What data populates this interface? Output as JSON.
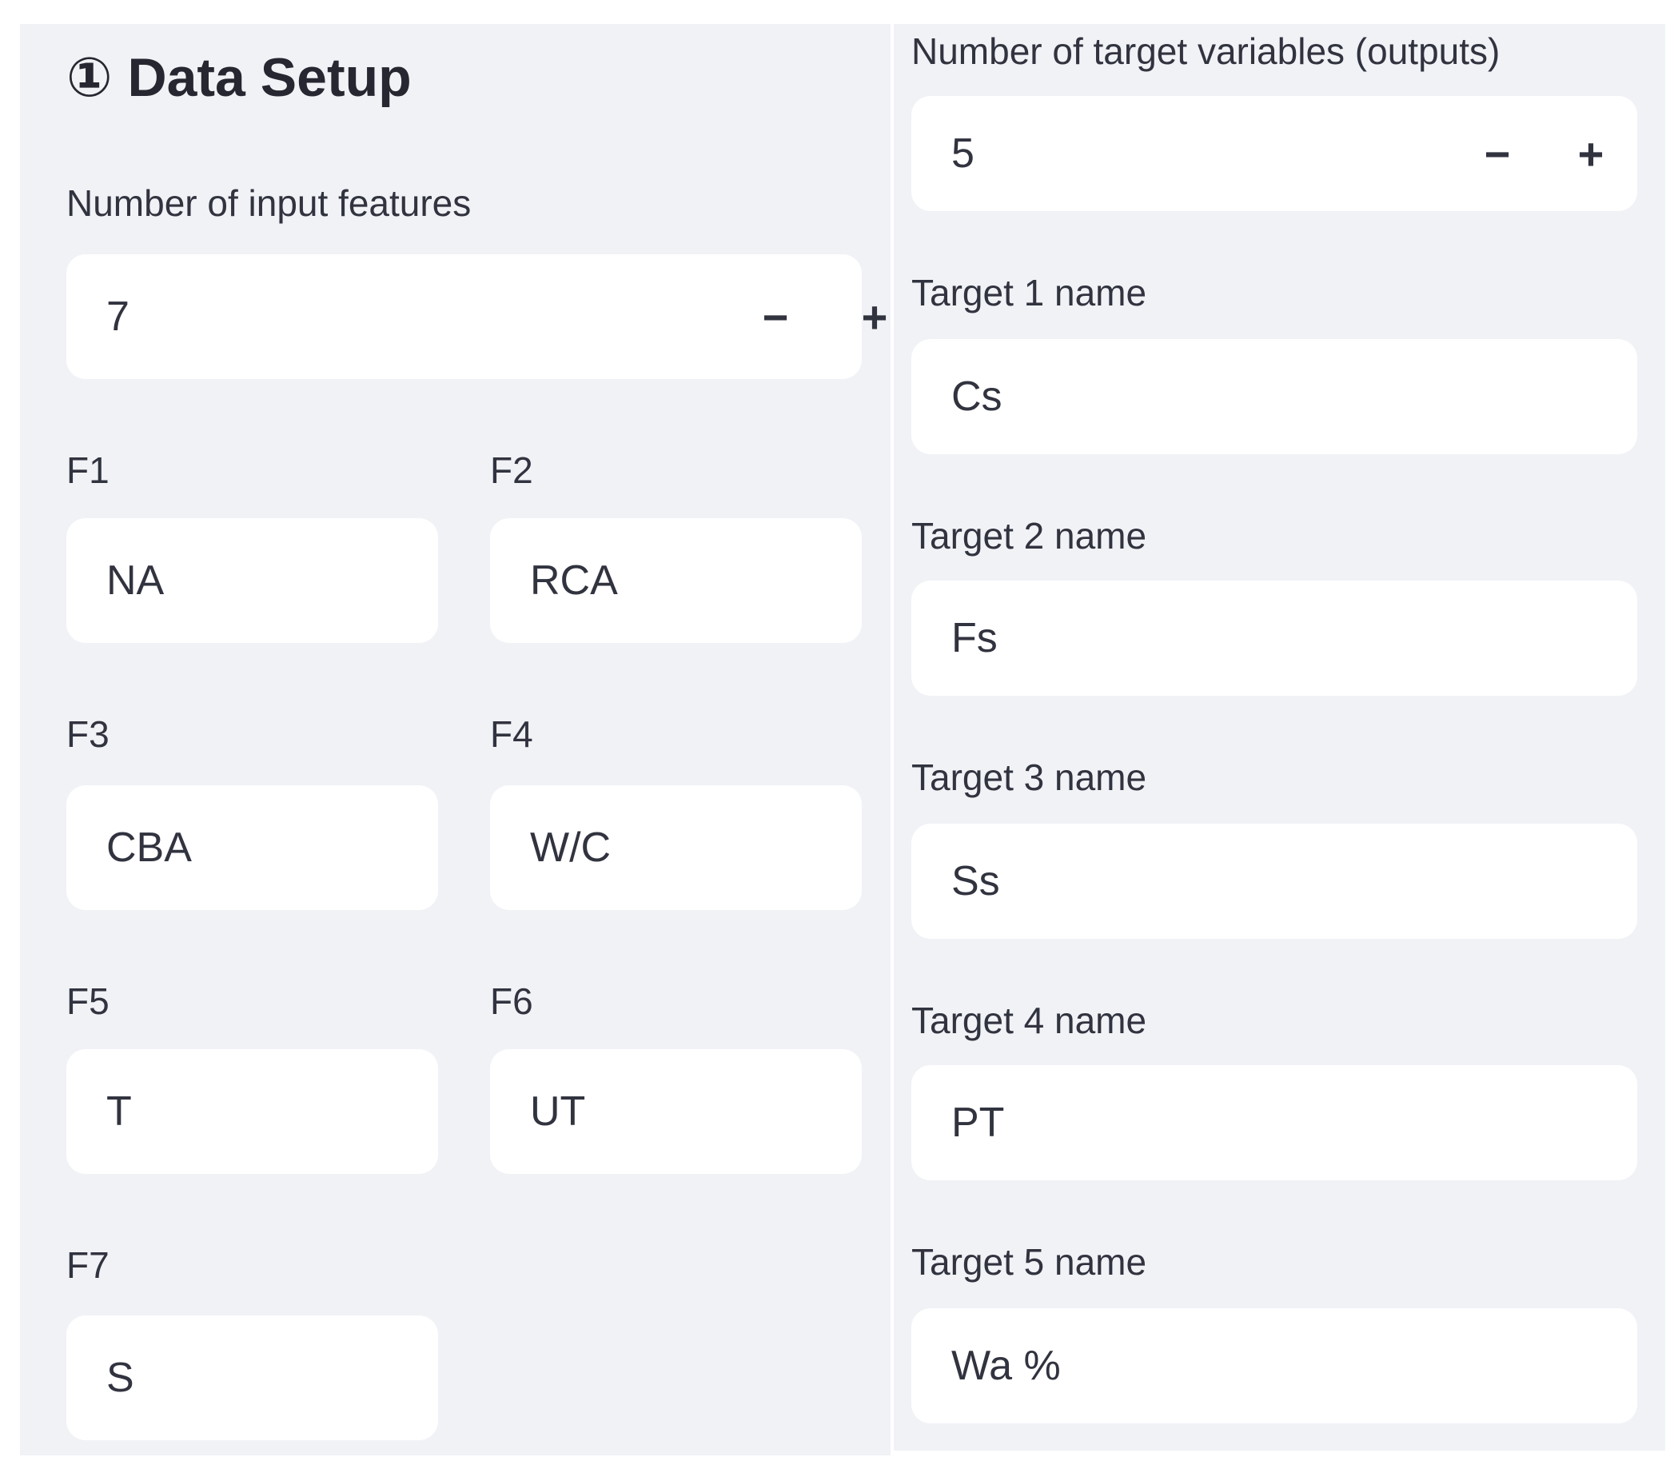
{
  "section": {
    "icon": "circled-digit-one-icon",
    "icon_glyph": "①",
    "title": "Data Setup"
  },
  "steppers": {
    "minus_glyph": "−",
    "plus_glyph": "+"
  },
  "input_features": {
    "label": "Number of input features",
    "value": "7",
    "fields": [
      {
        "label": "F1",
        "value": "NA"
      },
      {
        "label": "F2",
        "value": "RCA"
      },
      {
        "label": "F3",
        "value": "CBA"
      },
      {
        "label": "F4",
        "value": "W/C"
      },
      {
        "label": "F5",
        "value": "T"
      },
      {
        "label": "F6",
        "value": "UT"
      },
      {
        "label": "F7",
        "value": "S"
      }
    ]
  },
  "targets": {
    "label": "Number of target variables (outputs)",
    "value": "5",
    "fields": [
      {
        "label": "Target 1 name",
        "value": "Cs"
      },
      {
        "label": "Target 2 name",
        "value": "Fs"
      },
      {
        "label": "Target 3 name",
        "value": "Ss"
      },
      {
        "label": "Target 4 name",
        "value": "PT"
      },
      {
        "label": "Target 5 name",
        "value": "Wa %"
      }
    ]
  }
}
